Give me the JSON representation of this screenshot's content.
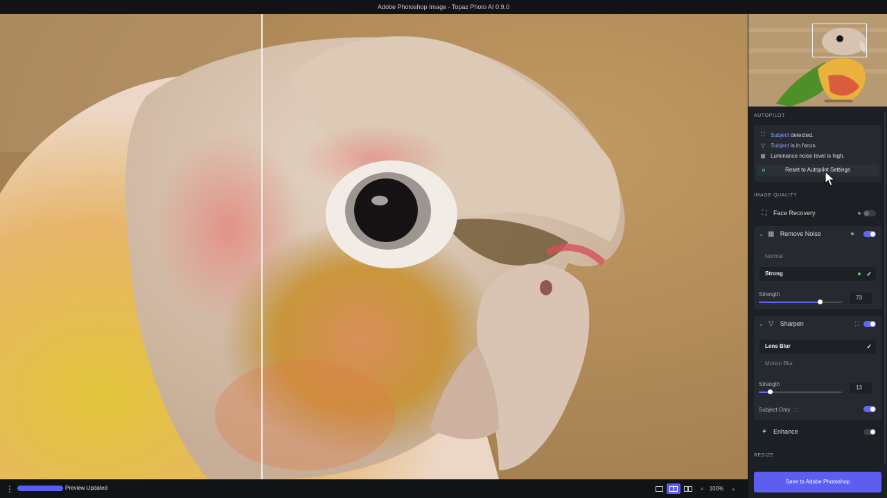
{
  "window": {
    "title": "Adobe Photoshop Image - Topaz Photo AI 0.9.0"
  },
  "autopilot": {
    "section_title": "AUTOPILOT",
    "lines": [
      {
        "highlight": "Subject",
        "rest": " detected."
      },
      {
        "highlight": "Subject",
        "rest": " is in focus."
      },
      {
        "highlight": "",
        "rest": "Luminance noise level is high."
      }
    ],
    "reset_label": "Reset to Autopilot Settings"
  },
  "image_quality": {
    "section_title": "IMAGE QUALITY",
    "face_recovery": {
      "label": "Face Recovery",
      "enabled": false,
      "locked": true
    },
    "remove_noise": {
      "label": "Remove Noise",
      "enabled": true,
      "options": [
        "Normal",
        "Strong"
      ],
      "selected": "Strong",
      "strength_label": "Strength",
      "strength": "73",
      "strength_fraction": 0.73
    },
    "sharpen": {
      "label": "Sharpen",
      "enabled": true,
      "options": [
        "Lens Blur",
        "Motion Blur"
      ],
      "selected": "Lens Blur",
      "strength_label": "Strength",
      "strength": "13",
      "strength_fraction": 0.13,
      "subject_only_label": "Subject Only",
      "subject_only": true
    },
    "enhance": {
      "label": "Enhance",
      "enabled": false
    }
  },
  "resize": {
    "section_title": "RESIZE"
  },
  "save_button": "Save to Adobe Photoshop",
  "status": {
    "preview_label": "Preview Updated",
    "zoom": "100%"
  },
  "colors": {
    "accent": "#5b5ef0",
    "active_dot": "#5bc66b",
    "link": "#8aa4f5"
  }
}
